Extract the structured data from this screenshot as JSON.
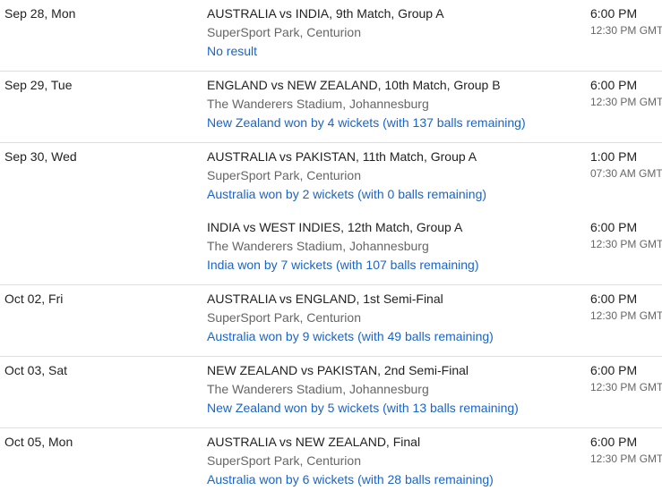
{
  "days": [
    {
      "date": "Sep 28, Mon",
      "matches": [
        {
          "title": "AUSTRALIA vs INDIA, 9th Match, Group A",
          "venue": "SuperSport Park, Centurion",
          "result": "No result",
          "local_time": "6:00 PM",
          "gmt_time": "12:30 PM GMT"
        }
      ]
    },
    {
      "date": "Sep 29, Tue",
      "matches": [
        {
          "title": "ENGLAND vs NEW ZEALAND, 10th Match, Group B",
          "venue": "The Wanderers Stadium, Johannesburg",
          "result": "New Zealand won by 4 wickets (with 137 balls remaining)",
          "local_time": "6:00 PM",
          "gmt_time": "12:30 PM GMT"
        }
      ]
    },
    {
      "date": "Sep 30, Wed",
      "matches": [
        {
          "title": "AUSTRALIA vs PAKISTAN, 11th Match, Group A",
          "venue": "SuperSport Park, Centurion",
          "result": "Australia won by 2 wickets (with 0 balls remaining)",
          "local_time": "1:00 PM",
          "gmt_time": "07:30 AM GMT"
        },
        {
          "title": "INDIA vs WEST INDIES, 12th Match, Group A",
          "venue": "The Wanderers Stadium, Johannesburg",
          "result": "India won by 7 wickets (with 107 balls remaining)",
          "local_time": "6:00 PM",
          "gmt_time": "12:30 PM GMT"
        }
      ]
    },
    {
      "date": "Oct 02, Fri",
      "matches": [
        {
          "title": "AUSTRALIA vs ENGLAND, 1st Semi-Final",
          "venue": "SuperSport Park, Centurion",
          "result": "Australia won by 9 wickets (with 49 balls remaining)",
          "local_time": "6:00 PM",
          "gmt_time": "12:30 PM GMT"
        }
      ]
    },
    {
      "date": "Oct 03, Sat",
      "matches": [
        {
          "title": "NEW ZEALAND vs PAKISTAN, 2nd Semi-Final",
          "venue": "The Wanderers Stadium, Johannesburg",
          "result": "New Zealand won by 5 wickets (with 13 balls remaining)",
          "local_time": "6:00 PM",
          "gmt_time": "12:30 PM GMT"
        }
      ]
    },
    {
      "date": "Oct 05, Mon",
      "matches": [
        {
          "title": "AUSTRALIA vs NEW ZEALAND, Final",
          "venue": "SuperSport Park, Centurion",
          "result": "Australia won by 6 wickets (with 28 balls remaining)",
          "local_time": "6:00 PM",
          "gmt_time": "12:30 PM GMT"
        }
      ]
    }
  ]
}
